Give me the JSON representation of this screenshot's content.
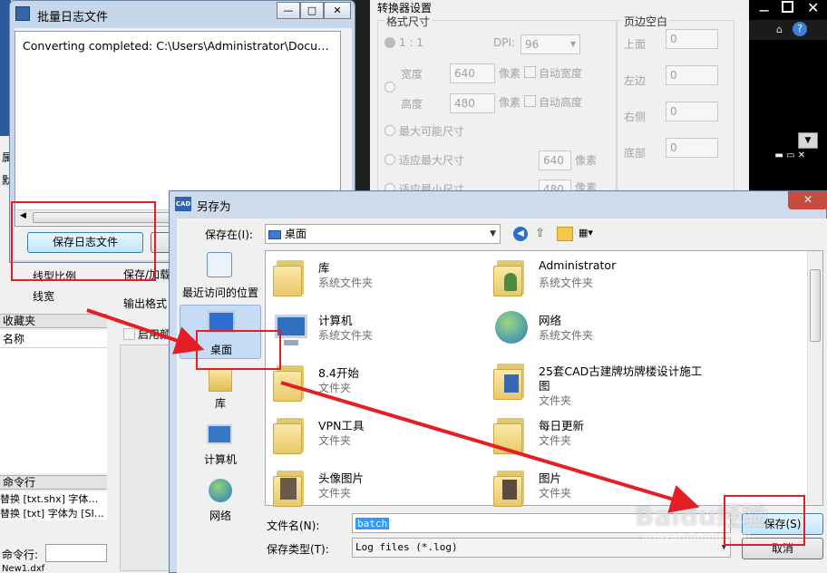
{
  "cad": {
    "left_labels": {
      "attr_row": "属",
      "default_row": "默",
      "linetype_scale": "线型比例",
      "linewidth": "线宽"
    },
    "favorites": {
      "title": "收藏夹",
      "name_header": "名称"
    },
    "command": {
      "title": "命令行",
      "line1": "替换 [txt.shx] 字体为 [SI",
      "line2": "替换 [txt] 字体为 [SIMP",
      "prompt_label": "命令行:",
      "file_tab": "New1.dxf"
    },
    "right_title_glyph": "?",
    "mid_labels": {
      "save_load": "保存/加载",
      "output_format": "输出格式",
      "enable_label": "启用颜"
    }
  },
  "converter": {
    "title": "转换器设置",
    "format_size": {
      "title": "格式尺寸",
      "ratio_label": "1 : 1",
      "dpi_label": "DPI:",
      "dpi_value": "96",
      "width_label": "宽度",
      "width_value": "640",
      "width_unit": "像素",
      "auto_width": "自动宽度",
      "height_label": "高度",
      "height_value": "480",
      "height_unit": "像素",
      "auto_height": "自动高度",
      "max_possible": "最大可能尺寸",
      "fit_max": "适应最大尺寸",
      "fit_max_value": "640",
      "fit_max_unit": "像素",
      "fit_min": "适应最小尺寸",
      "fit_min_value": "480",
      "fit_min_unit": "像素"
    },
    "margins": {
      "title": "页边空白",
      "top_label": "上面",
      "top_value": "0",
      "left_label": "左边",
      "left_value": "0",
      "right_label": "右侧",
      "right_value": "0",
      "bottom_label": "底部",
      "bottom_value": "0"
    }
  },
  "log_window": {
    "title": "批量日志文件",
    "log_text": "Converting completed: C:\\Users\\Administrator\\Documents\\CAD",
    "save_button": "保存日志文件",
    "minimize": "—",
    "maximize": "□",
    "close": "✕"
  },
  "save_as": {
    "title": "另存为",
    "app_badge": "CAD",
    "save_in_label": "保存在(I):",
    "save_in_value": "桌面",
    "places": [
      {
        "label": "最近访问的位置"
      },
      {
        "label": "桌面"
      },
      {
        "label": "库"
      },
      {
        "label": "计算机"
      },
      {
        "label": "网络"
      }
    ],
    "items": [
      {
        "name": "库",
        "type": "系统文件夹"
      },
      {
        "name": "Administrator",
        "type": "系统文件夹"
      },
      {
        "name": "计算机",
        "type": "系统文件夹"
      },
      {
        "name": "网络",
        "type": "系统文件夹"
      },
      {
        "name": "8.4开始",
        "type": "文件夹"
      },
      {
        "name": "25套CAD古建牌坊牌楼设计施工",
        "name2": "图",
        "type": "文件夹"
      },
      {
        "name": "VPN工具",
        "type": "文件夹"
      },
      {
        "name": "每日更新",
        "type": "文件夹"
      },
      {
        "name": "头像图片",
        "type": "文件夹"
      },
      {
        "name": "图片",
        "type": "文件夹"
      }
    ],
    "filename_label": "文件名(N):",
    "filename_value": "batch",
    "filetype_label": "保存类型(T):",
    "filetype_value": "Log files (*.log)",
    "save_button": "保存(S)",
    "cancel_button": "取消",
    "close": "✕"
  },
  "watermark": {
    "brand": "Baidu经验",
    "url": "jingyan.baidu.com"
  },
  "colors": {
    "annotation_red": "#e31e24",
    "selection_blue": "#3399ff",
    "title_blue": "#cfdbea"
  }
}
